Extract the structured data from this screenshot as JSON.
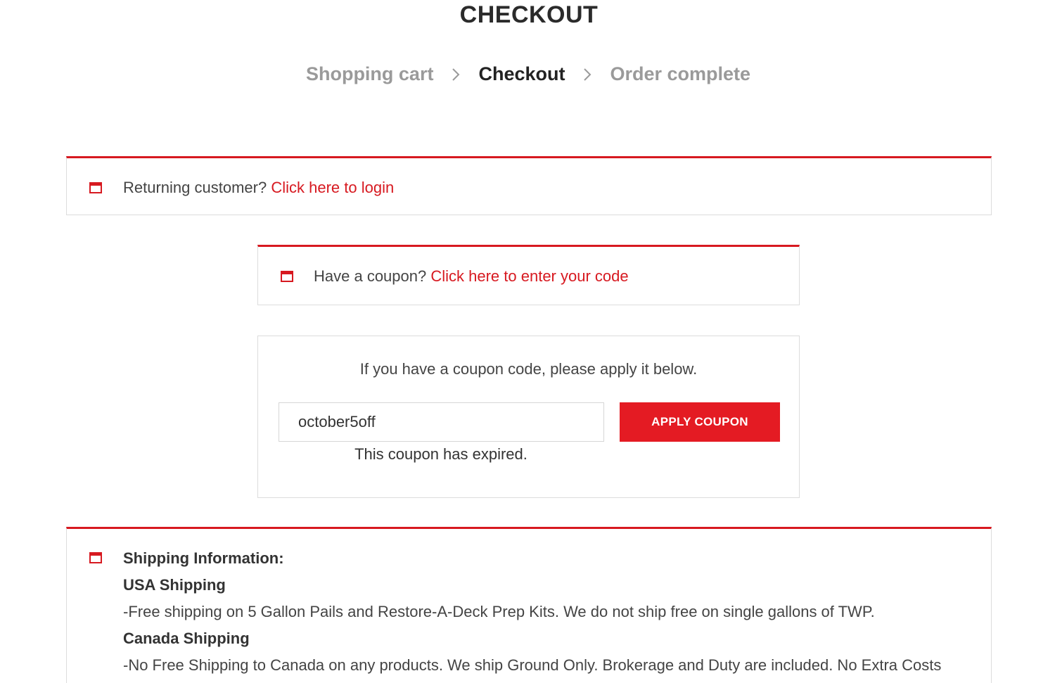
{
  "page": {
    "title": "CHECKOUT"
  },
  "steps": [
    {
      "label": "Shopping cart",
      "state": "inactive"
    },
    {
      "label": "Checkout",
      "state": "active"
    },
    {
      "label": "Order complete",
      "state": "inactive"
    }
  ],
  "login_notice": {
    "text": "Returning customer?",
    "link": "Click here to login"
  },
  "coupon_notice": {
    "text": "Have a coupon?",
    "link": "Click here to enter your code"
  },
  "coupon_form": {
    "intro": "If you have a coupon code, please apply it below.",
    "input_value": "october5off",
    "button_label": "APPLY COUPON",
    "error": "This coupon has expired."
  },
  "shipping_info": {
    "heading": "Shipping Information:",
    "usa_heading": "USA Shipping",
    "usa_text": "-Free shipping on 5 Gallon Pails and Restore-A-Deck Prep Kits. We do not ship free on single gallons of TWP.",
    "canada_heading": "Canada Shipping",
    "canada_text": "-No Free Shipping to Canada on any products. We ship Ground Only. Brokerage and Duty are included. No Extra Costs"
  },
  "colors": {
    "accent": "#d71920",
    "button": "#e41b23",
    "border": "#dcdcdc"
  },
  "icons": {
    "notice_icon": "window-icon",
    "step_separator": "chevron-right-icon"
  }
}
